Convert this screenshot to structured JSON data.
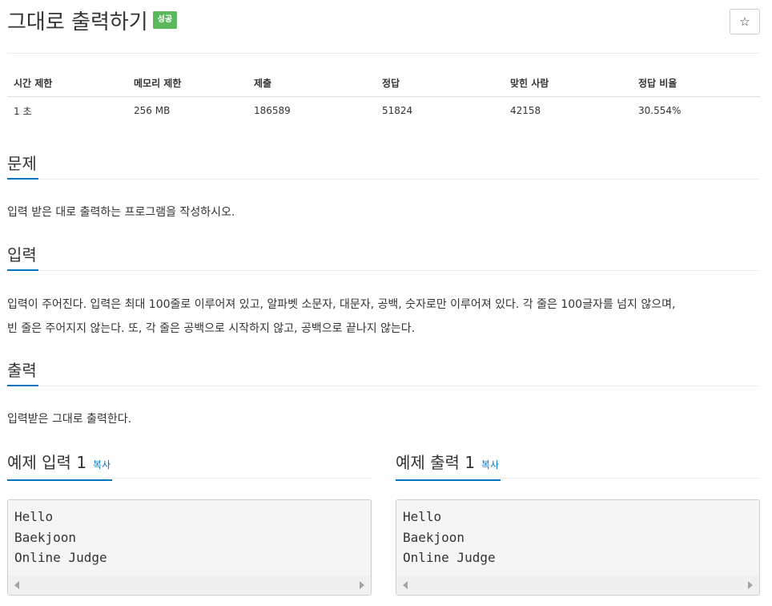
{
  "problem": {
    "title": "그대로 출력하기",
    "status_badge": "성공",
    "star_icon": "☆"
  },
  "info_table": {
    "headers": [
      "시간 제한",
      "메모리 제한",
      "제출",
      "정답",
      "맞힌 사람",
      "정답 비율"
    ],
    "values": [
      "1 초",
      "256 MB",
      "186589",
      "51824",
      "42158",
      "30.554%"
    ]
  },
  "sections": {
    "description": {
      "heading": "문제",
      "text": "입력 받은 대로 출력하는 프로그램을 작성하시오."
    },
    "input": {
      "heading": "입력",
      "line1": "입력이 주어진다. 입력은 최대 100줄로 이루어져 있고, 알파벳 소문자, 대문자, 공백, 숫자로만 이루어져 있다. 각 줄은 100글자를 넘지 않으며,",
      "line2": "빈 줄은 주어지지 않는다. 또, 각 줄은 공백으로 시작하지 않고, 공백으로 끝나지 않는다."
    },
    "output": {
      "heading": "출력",
      "text": "입력받은 그대로 출력한다."
    }
  },
  "samples": {
    "input": {
      "heading": "예제 입력 1",
      "copy_label": "복사",
      "content": "Hello\nBaekjoon\nOnline Judge"
    },
    "output": {
      "heading": "예제 출력 1",
      "copy_label": "복사",
      "content": "Hello\nBaekjoon\nOnline Judge"
    }
  },
  "colors": {
    "accent": "#0076c0",
    "success_badge": "#5cb85c"
  }
}
